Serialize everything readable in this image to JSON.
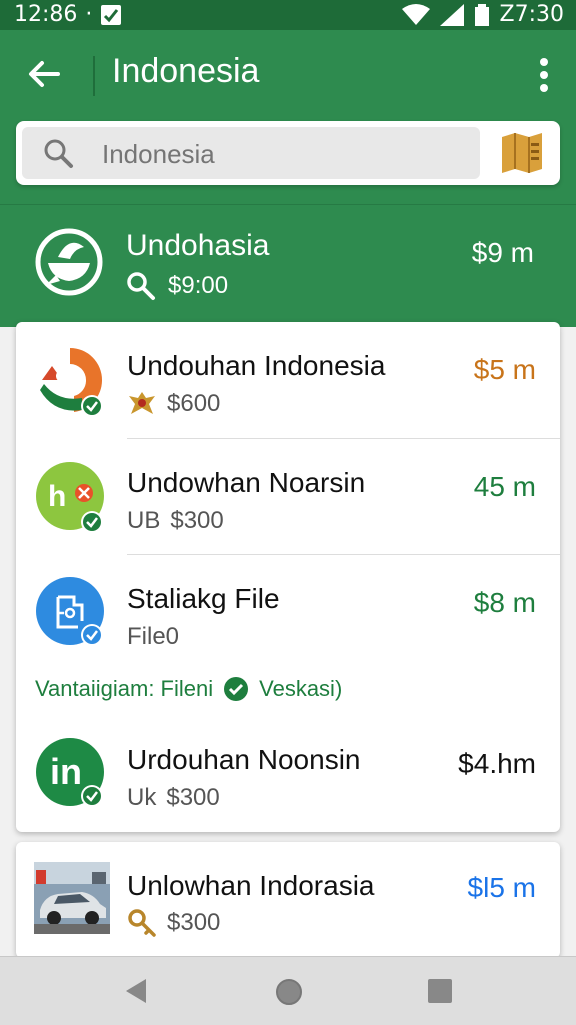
{
  "status_bar": {
    "time": "12:86",
    "dot": "·",
    "right_time": "Z7:30"
  },
  "app_bar": {
    "title": "Indonesia"
  },
  "search": {
    "placeholder": "Indonesia"
  },
  "header": {
    "name": "Undohasia",
    "price": "$9:00",
    "distance": "$9 m"
  },
  "results": [
    {
      "title": "Undouhan Indonesia",
      "sub": "$600",
      "distance": "$5 m",
      "distance_color": "#c8741a"
    },
    {
      "title": "Undowhan Noarsin",
      "sub_prefix": "UB",
      "sub": "$300",
      "distance": "45 m",
      "distance_color": "#1e7e3e"
    },
    {
      "title": "Staliakg File",
      "sub": "File0",
      "distance": "$8 m",
      "distance_color": "#1e7e3e"
    },
    {
      "title": "Urdouhan Noonsin",
      "sub_prefix": "Uk",
      "sub": "$300",
      "distance": "$4.hm",
      "distance_color": "#111111"
    },
    {
      "title": "Unlowhan Indorasia",
      "sub": "$300",
      "distance": "$l5 m",
      "distance_color": "#1a73e8"
    }
  ],
  "verified_note": {
    "left": "Vantaiigiam: Fileni",
    "right": "Veskasi)"
  },
  "avatars": {
    "row2_text": "h",
    "row4_text": "in"
  },
  "colors": {
    "primary": "#2e8b4f",
    "status": "#1e6b38",
    "check": "#1e7e3e"
  }
}
